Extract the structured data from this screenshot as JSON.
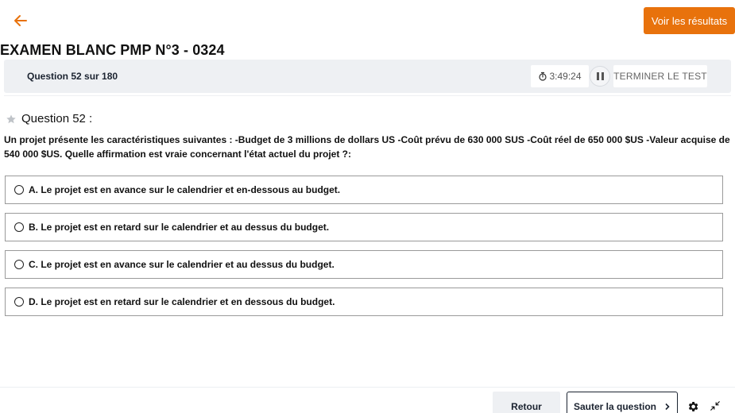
{
  "header": {
    "back_icon": "arrow-left-icon",
    "results_button": "Voir les résultats",
    "accent_color": "#e8720c"
  },
  "exam": {
    "title": "EXAMEN BLANC PMP N°3 - 0324"
  },
  "question_bar": {
    "counter": "Question 52 sur 180",
    "timer": "3:49:24",
    "timer_icon": "stopwatch-icon",
    "pause_icon": "pause-icon",
    "end_test_button": "TERMINER LE TEST"
  },
  "question": {
    "star_icon": "star-icon",
    "label": "Question 52 :",
    "text": "Un projet présente les caractéristiques suivantes : -Budget de 3 millions de dollars US -Coût prévu de 630 000 SUS -Coût réel de 650 000 $US -Valeur acquise de 540 000 $US. Quelle affirmation est vraie concernant l'état actuel du projet ?:",
    "options": [
      {
        "label": "A. Le projet est en avance sur le calendrier et en-dessous au budget."
      },
      {
        "label": "B. Le projet est en retard sur le calendrier et au dessus du budget."
      },
      {
        "label": "C. Le projet est en avance sur le calendrier et au dessus du budget."
      },
      {
        "label": "D. Le projet est en retard sur le calendrier et en dessous du budget."
      }
    ]
  },
  "footer": {
    "back_button": "Retour",
    "skip_button": "Sauter la question",
    "skip_icon": "chevron-right-icon",
    "settings_icon": "gear-icon",
    "collapse_icon": "collapse-icon"
  }
}
